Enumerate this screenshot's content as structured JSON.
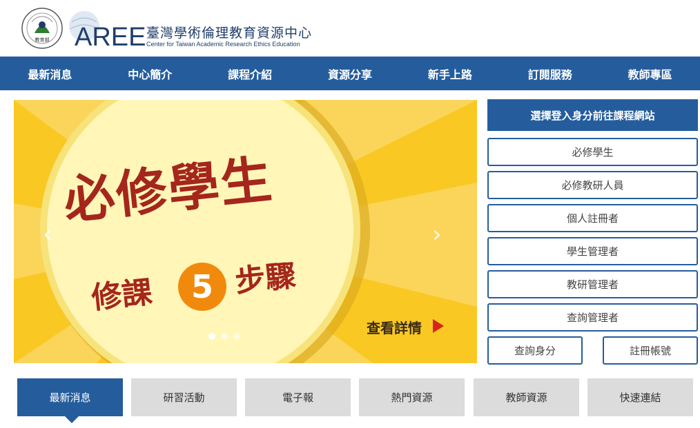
{
  "header": {
    "moe_logo_text": "MINISTRY OF EDUCATION",
    "moe_logo_zh": "教育部",
    "logo_text": "AREE",
    "title_zh": "臺灣學術倫理教育資源中心",
    "title_en": "Center for Taiwan Academic Research Ethics Education"
  },
  "nav": {
    "items": [
      {
        "label": "最新消息"
      },
      {
        "label": "中心簡介"
      },
      {
        "label": "課程介紹"
      },
      {
        "label": "資源分享"
      },
      {
        "label": "新手上路"
      },
      {
        "label": "訂閱服務"
      },
      {
        "label": "教師專區"
      }
    ]
  },
  "banner": {
    "title": "必修學生",
    "subtitle_left": "修課",
    "step_number": "5",
    "subtitle_right": "步驟",
    "more_label": "查看詳情",
    "prev_icon": "‹",
    "next_icon": "›",
    "slide_count": 3,
    "active_slide": 1
  },
  "sidebar": {
    "header": "選擇登入身分前往課程網站",
    "buttons": [
      {
        "label": "必修學生"
      },
      {
        "label": "必修教研人員"
      },
      {
        "label": "個人註冊者"
      },
      {
        "label": "學生管理者"
      },
      {
        "label": "教研管理者"
      },
      {
        "label": "查詢管理者"
      }
    ],
    "bottom_buttons": [
      {
        "label": "查詢身分"
      },
      {
        "label": "註冊帳號"
      }
    ]
  },
  "tabs": [
    {
      "label": "最新消息",
      "active": true
    },
    {
      "label": "研習活動"
    },
    {
      "label": "電子報"
    },
    {
      "label": "熱門資源"
    },
    {
      "label": "教師資源"
    },
    {
      "label": "快速連結"
    }
  ],
  "colors": {
    "primary": "#255d9c",
    "banner_yellow": "#f9c823",
    "banner_red": "#a4261c",
    "step_orange": "#f18a0c"
  }
}
